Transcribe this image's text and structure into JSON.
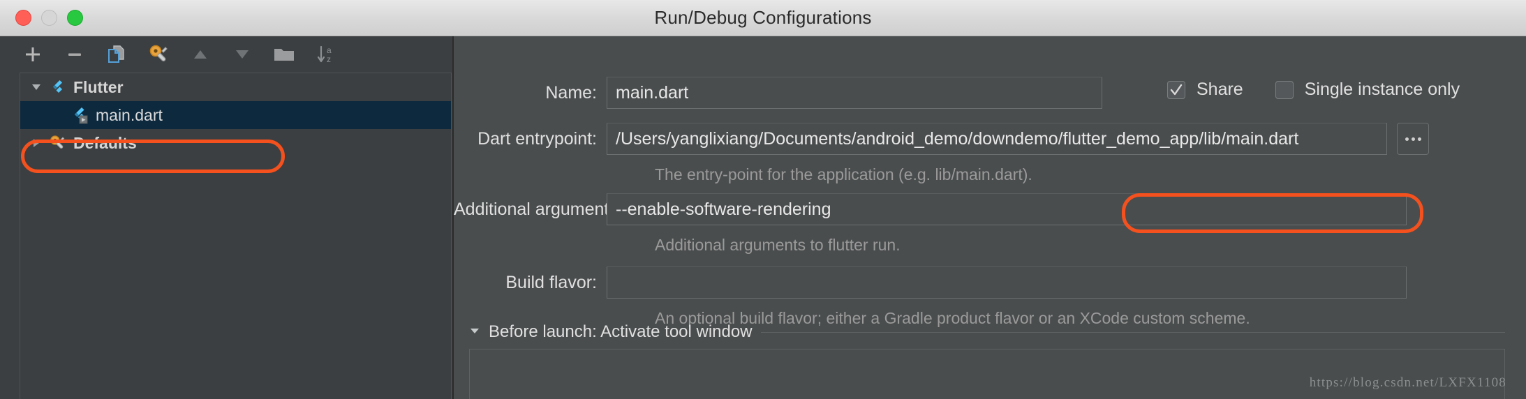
{
  "window": {
    "title": "Run/Debug Configurations",
    "traffic_lights": [
      "close",
      "minimize",
      "zoom"
    ]
  },
  "toolbar": {
    "buttons": [
      {
        "name": "add-button",
        "icon": "plus-icon",
        "label": "Add New Configuration",
        "enabled": true
      },
      {
        "name": "remove-button",
        "icon": "minus-icon",
        "label": "Remove Configuration",
        "enabled": true
      },
      {
        "name": "copy-button",
        "icon": "copy-icon",
        "label": "Copy Configuration",
        "enabled": true
      },
      {
        "name": "edit-defaults-button",
        "icon": "wrench-icon",
        "label": "Edit Defaults",
        "enabled": true
      },
      {
        "name": "move-up-button",
        "icon": "triangle-up-icon",
        "label": "Move Up",
        "enabled": false
      },
      {
        "name": "move-down-button",
        "icon": "triangle-down-icon",
        "label": "Move Down",
        "enabled": false
      },
      {
        "name": "new-folder-button",
        "icon": "folder-icon",
        "label": "Create New Folder",
        "enabled": true
      },
      {
        "name": "sort-button",
        "icon": "sort-az-icon",
        "label": "Sort Configurations",
        "enabled": false
      }
    ]
  },
  "tree": {
    "nodes": [
      {
        "label": "Flutter",
        "icon": "flutter-icon",
        "twisty": "expanded",
        "indent": 0,
        "selected": false,
        "bold": true
      },
      {
        "label": "main.dart",
        "icon": "flutter-run-icon",
        "twisty": "none",
        "indent": 1,
        "selected": true,
        "bold": false
      },
      {
        "label": "Defaults",
        "icon": "wrench-icon",
        "twisty": "collapsed",
        "indent": 0,
        "selected": false,
        "bold": true
      }
    ]
  },
  "form": {
    "name": {
      "label": "Name:",
      "value": "main.dart",
      "placeholder": ""
    },
    "share": {
      "label": "Share",
      "checked": true
    },
    "single_instance": {
      "label": "Single instance only",
      "checked": false
    },
    "dart_entrypoint": {
      "label": "Dart entrypoint:",
      "value": "/Users/yanglixiang/Documents/android_demo/downdemo/flutter_demo_app/lib/main.dart",
      "placeholder": "",
      "hint": "The entry-point for the application (e.g. lib/main.dart).",
      "browse_label": "..."
    },
    "additional_arguments": {
      "label": "Additional arguments:",
      "value": "--enable-software-rendering",
      "placeholder": "",
      "hint": "Additional arguments to flutter run."
    },
    "build_flavor": {
      "label": "Build flavor:",
      "value": "",
      "placeholder": "",
      "hint": "An optional build flavor; either a Gradle product flavor or an XCode custom scheme."
    },
    "before_launch": {
      "label": "Before launch: Activate tool window",
      "twisty": "expanded"
    }
  },
  "annotations": {
    "highlight_color": "#f4511e",
    "highlighted": [
      "tree-item-main-dart",
      "additional-arguments-field"
    ]
  },
  "watermark": {
    "text": "https://blog.csdn.net/LXFX1108"
  },
  "colors": {
    "window_background": "#3c3f41",
    "right_panel_background": "#4a4d4e",
    "titlebar_background": "#d8d8d8",
    "selection_background": "#0d293e",
    "accent_highlight": "#f4511e",
    "flutter_blue": "#54c5f8",
    "hint_text": "#9a9a9a"
  }
}
